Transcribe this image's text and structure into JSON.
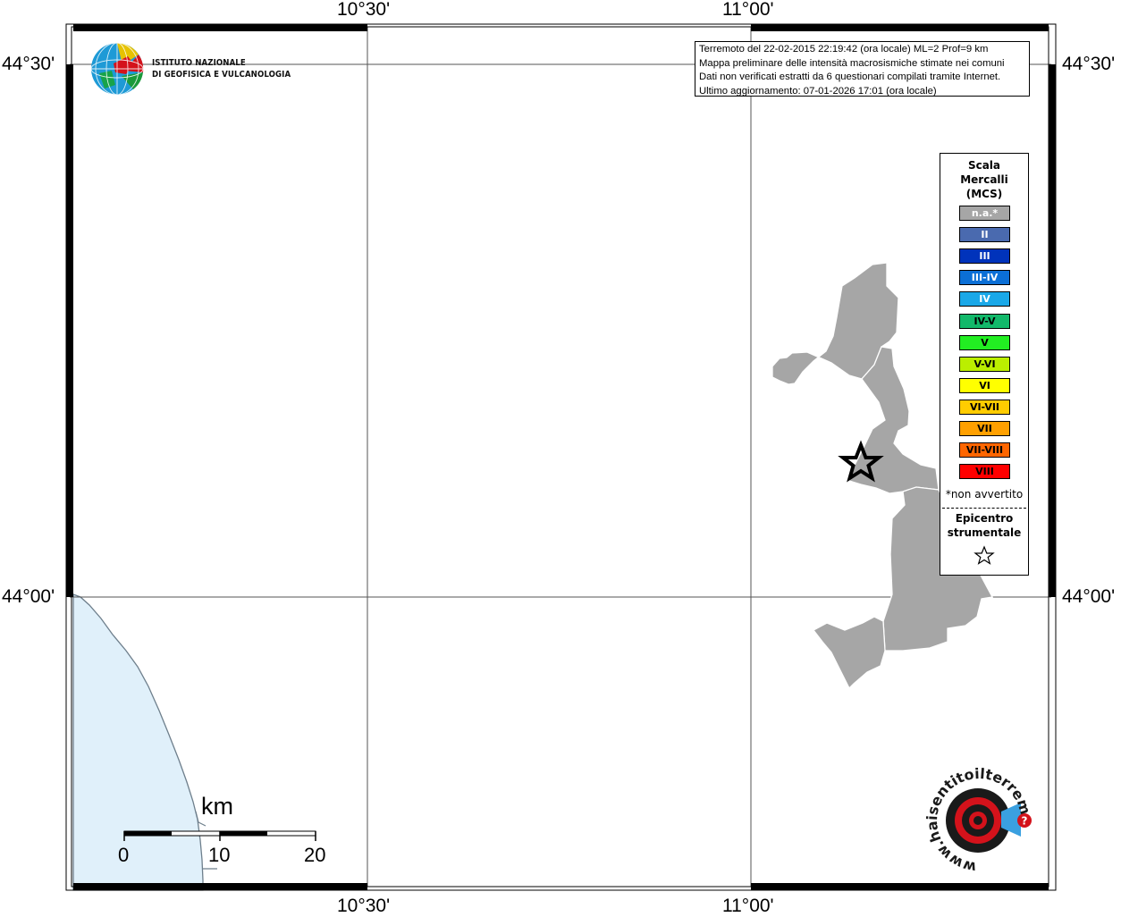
{
  "map": {
    "lon_labels": [
      "10°30'",
      "11°00'"
    ],
    "lat_labels": [
      "44°30'",
      "44°00'"
    ]
  },
  "logo": {
    "name_line1": "ISTITUTO NAZIONALE",
    "name_line2": "DI GEOFISICA E VULCANOLOGIA"
  },
  "info": {
    "line1": "Terremoto del 22-02-2015 22:19:42 (ora locale) ML=2 Prof=9 km",
    "line2": "Mappa preliminare delle intensità macrosismiche stimate nei comuni",
    "line3": "Dati non verificati estratti da 6 questionari compilati tramite Internet.",
    "line4": "Ultimo aggiornamento: 07-01-2026 17:01 (ora locale)"
  },
  "legend": {
    "title_line1": "Scala",
    "title_line2": "Mercalli",
    "title_line3": "(MCS)",
    "items": [
      {
        "label": "n.a.*",
        "color": "#a6a6a6",
        "text_color": "#ffffff"
      },
      {
        "label": "II",
        "color": "#4a6aaf",
        "text_color": "#ffffff"
      },
      {
        "label": "III",
        "color": "#0033bb",
        "text_color": "#ffffff"
      },
      {
        "label": "III-IV",
        "color": "#0b6fd6",
        "text_color": "#ffffff"
      },
      {
        "label": "IV",
        "color": "#1aa8e8",
        "text_color": "#ffffff"
      },
      {
        "label": "IV-V",
        "color": "#12b86a",
        "text_color": "#000000"
      },
      {
        "label": "V",
        "color": "#22ee22",
        "text_color": "#000000"
      },
      {
        "label": "V-VI",
        "color": "#bbee00",
        "text_color": "#000000"
      },
      {
        "label": "VI",
        "color": "#ffff00",
        "text_color": "#000000"
      },
      {
        "label": "VI-VII",
        "color": "#ffcc00",
        "text_color": "#000000"
      },
      {
        "label": "VII",
        "color": "#ffa000",
        "text_color": "#000000"
      },
      {
        "label": "VII-VIII",
        "color": "#ff6600",
        "text_color": "#000000"
      },
      {
        "label": "VIII",
        "color": "#ff0000",
        "text_color": "#000000"
      }
    ],
    "note": "*non avvertito",
    "epicenter_line1": "Epicentro",
    "epicenter_line2": "strumentale"
  },
  "scalebar": {
    "unit": "km",
    "ticks": [
      "0",
      "10",
      "20"
    ]
  },
  "brand": {
    "site_text": "www.haisentitoilterremoto.it",
    "accent": "#d4121b"
  },
  "colors": {
    "sea": "#e0f0fa",
    "coast": "#6e7f8c",
    "municipality": "#a6a6a6",
    "frame": "#000000",
    "grid": "#555555"
  }
}
